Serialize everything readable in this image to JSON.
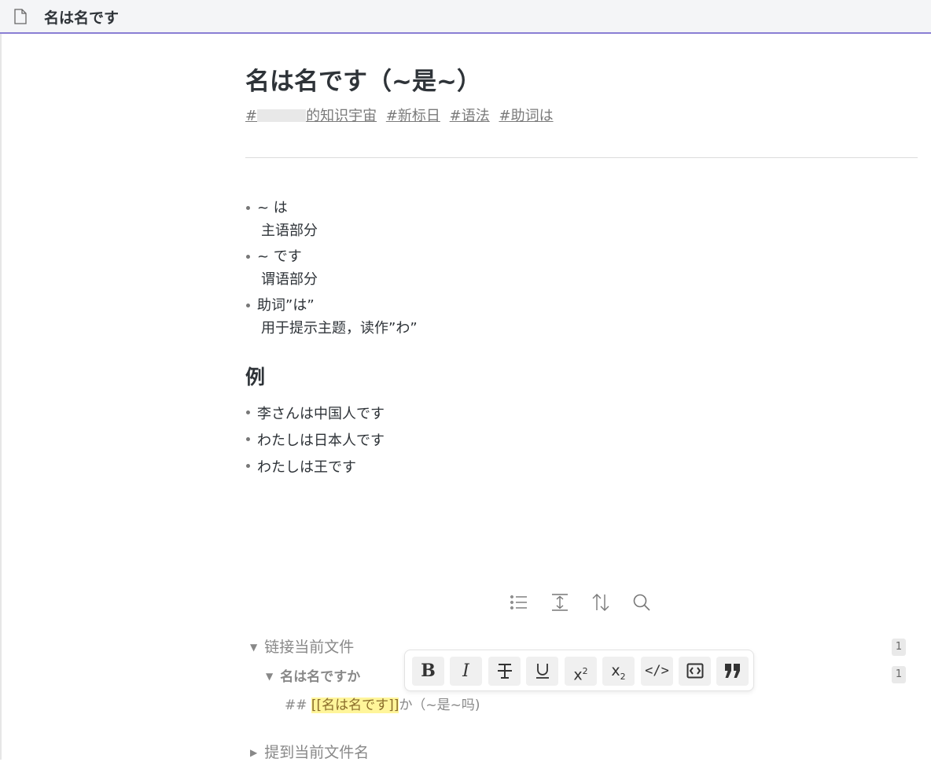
{
  "tab": {
    "title": "名は名です"
  },
  "note": {
    "title": "名は名です（~是~）",
    "tags": [
      "𝄻𝄻𝄻的知识宇宙",
      "#新标日",
      "#语法",
      "#助词は"
    ],
    "tag_first_suffix": "的知识宇宙",
    "points": [
      {
        "term": "~ は",
        "desc": "主语部分"
      },
      {
        "term": "~ です",
        "desc": "谓语部分"
      },
      {
        "term": "助词”は”",
        "desc": "用于提示主题，读作”わ”"
      }
    ],
    "example_heading": "例",
    "examples": [
      "李さんは中国人です",
      "わたしは日本人です",
      "わたしは王です"
    ]
  },
  "backlinks": {
    "toolbar_icons": [
      "list-icon",
      "expand-icon",
      "sort-icon",
      "search-icon"
    ],
    "linked_title": "链接当前文件",
    "linked_count": "1",
    "file_name": "名は名ですか",
    "file_count": "1",
    "ref_prefix": "## ",
    "ref_link": "[[名は名です]]",
    "ref_suffix": "か（~是~吗)",
    "mentions_title": "提到当前文件名"
  },
  "format_toolbar": {
    "buttons": [
      {
        "icon": "bold-icon",
        "glyph": "B"
      },
      {
        "icon": "italic-icon",
        "glyph": "I"
      },
      {
        "icon": "strikethrough-icon",
        "glyph": "T"
      },
      {
        "icon": "underline-icon",
        "glyph": "U"
      },
      {
        "icon": "superscript-icon",
        "glyph": "x²"
      },
      {
        "icon": "subscript-icon",
        "glyph": "x₂"
      },
      {
        "icon": "code-icon",
        "glyph": "</>"
      },
      {
        "icon": "code-block-icon",
        "glyph": "<>"
      },
      {
        "icon": "quote-icon",
        "glyph": "❞"
      }
    ]
  }
}
